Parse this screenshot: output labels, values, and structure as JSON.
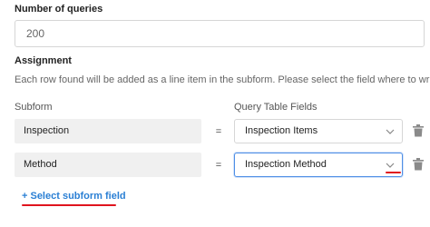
{
  "queries": {
    "label": "Number of queries",
    "value": "200"
  },
  "assignment": {
    "title": "Assignment",
    "hint": "Each row found will be added as a line item in the subform. Please select the field where to write.",
    "subform_header": "Subform",
    "fields_header": "Query Table Fields",
    "equals": "=",
    "rows": [
      {
        "subform": "Inspection",
        "field": "Inspection Items",
        "active": false
      },
      {
        "subform": "Method",
        "field": "Inspection Method",
        "active": true
      }
    ],
    "add_label": "+ Select subform field"
  },
  "icons": {
    "chevron": "chevron-down-icon",
    "delete": "trash-icon"
  },
  "colors": {
    "link": "#2a7fd4",
    "highlight": "#e0141e",
    "focus_border": "#4f8fe6"
  }
}
